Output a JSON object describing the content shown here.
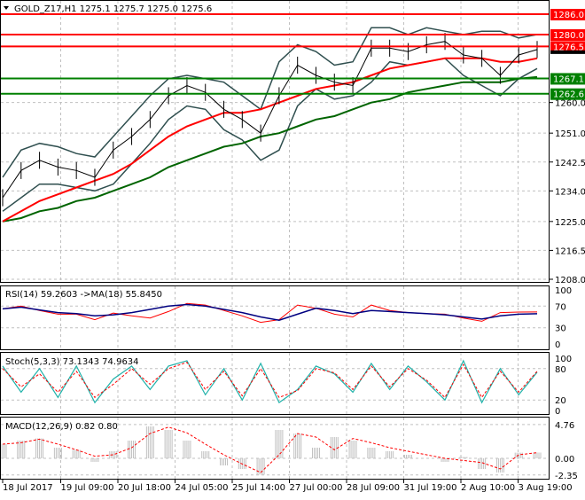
{
  "header": {
    "symbol_line": "GOLD_Z17,H1  1275.1 1275.7 1275.0 1275.6"
  },
  "colors": {
    "resistance": "#ff0000",
    "support": "#008000",
    "ma_fast": "#ff0000",
    "ma_slow": "#006400",
    "bands": "#2f4f4f",
    "rsi": "#ff0000",
    "rsi_ma": "#000080",
    "stoch_main": "#20b2aa",
    "stoch_signal": "#ff0000",
    "macd_hist": "#c0c0c0",
    "macd_signal": "#ff0000"
  },
  "chart_data": [
    {
      "type": "line",
      "title": "GOLD_Z17,H1",
      "ylim": [
        1208.0,
        1286.0
      ],
      "y_ticks": [
        "1260.0",
        "1251.0",
        "1242.5",
        "1234.0",
        "1225.0",
        "1216.5",
        "1208.0"
      ],
      "x_tick_labels": [
        "18 Jul 2017",
        "19 Jul 09:00",
        "20 Jul 18:00",
        "24 Jul 05:00",
        "25 Jul 14:00",
        "27 Jul 00:00",
        "28 Jul 09:00",
        "31 Jul 19:00",
        "2 Aug 10:00",
        "3 Aug 19:00"
      ],
      "levels": [
        {
          "value": "1286.0",
          "kind": "resistance"
        },
        {
          "value": "1280.0",
          "kind": "resistance"
        },
        {
          "value": "1276.5",
          "kind": "resistance"
        },
        {
          "value": "1267.1",
          "kind": "support"
        },
        {
          "value": "1262.6",
          "kind": "support"
        }
      ],
      "current_price": "1275.6",
      "series": {
        "close": [
          1232,
          1240,
          1243,
          1241,
          1240,
          1238,
          1246,
          1250,
          1255,
          1262,
          1265,
          1263,
          1258,
          1255,
          1251,
          1262,
          1271,
          1268,
          1266,
          1265,
          1276,
          1276,
          1275,
          1277,
          1278,
          1274,
          1273,
          1268,
          1274,
          1275.6
        ],
        "bb_upper": [
          1238,
          1246,
          1248,
          1247,
          1245,
          1244,
          1250,
          1256,
          1262,
          1267,
          1268,
          1267,
          1266,
          1262,
          1258,
          1272,
          1277,
          1275,
          1271,
          1272,
          1282,
          1282,
          1280,
          1282,
          1281,
          1280,
          1281,
          1281,
          1279,
          1280
        ],
        "bb_lower": [
          1228,
          1232,
          1236,
          1236,
          1235,
          1234,
          1236,
          1242,
          1248,
          1255,
          1259,
          1258,
          1252,
          1249,
          1243,
          1246,
          1259,
          1264,
          1261,
          1262,
          1266,
          1272,
          1271,
          1272,
          1273,
          1268,
          1265,
          1262,
          1267,
          1270
        ],
        "ma_fast": [
          1225,
          1228,
          1231,
          1233,
          1235,
          1237,
          1239,
          1242,
          1246,
          1250,
          1253,
          1255,
          1257,
          1257,
          1258,
          1260,
          1262,
          1264,
          1265,
          1266,
          1268,
          1270,
          1271,
          1272,
          1273,
          1273,
          1273,
          1272,
          1272,
          1273
        ],
        "ma_slow": [
          1225,
          1226,
          1228,
          1229,
          1231,
          1232,
          1234,
          1236,
          1238,
          1241,
          1243,
          1245,
          1247,
          1248,
          1250,
          1251,
          1253,
          1255,
          1256,
          1258,
          1260,
          1261,
          1263,
          1264,
          1265,
          1266,
          1266,
          1266,
          1267,
          1267.5
        ]
      }
    },
    {
      "type": "line",
      "title": "RSI(14) 59.2603  ->MA(18) 55.8450",
      "ylim": [
        0,
        100
      ],
      "y_ticks": [
        "100",
        "70",
        "30",
        "0"
      ],
      "series": {
        "rsi": [
          65,
          70,
          62,
          55,
          55,
          45,
          57,
          52,
          48,
          60,
          75,
          72,
          62,
          52,
          40,
          45,
          72,
          66,
          55,
          50,
          72,
          62,
          58,
          56,
          55,
          48,
          42,
          58,
          59,
          59.26
        ],
        "ma": [
          65,
          68,
          63,
          58,
          56,
          52,
          54,
          58,
          64,
          70,
          73,
          70,
          64,
          58,
          50,
          44,
          55,
          66,
          62,
          56,
          62,
          60,
          58,
          56,
          54,
          50,
          46,
          52,
          55,
          55.85
        ]
      }
    },
    {
      "type": "line",
      "title": "Stoch(5,3,3) 73.1343 74.9634",
      "ylim": [
        0,
        100
      ],
      "y_ticks": [
        "100",
        "80",
        "20",
        "0"
      ],
      "series": {
        "main": [
          85,
          35,
          80,
          25,
          85,
          15,
          60,
          85,
          40,
          85,
          95,
          30,
          80,
          20,
          90,
          15,
          40,
          85,
          70,
          35,
          90,
          40,
          85,
          55,
          20,
          95,
          15,
          80,
          30,
          73.13
        ],
        "signal": [
          80,
          45,
          70,
          35,
          75,
          25,
          50,
          80,
          50,
          80,
          92,
          40,
          75,
          28,
          80,
          25,
          38,
          80,
          72,
          40,
          85,
          45,
          80,
          58,
          25,
          88,
          25,
          75,
          35,
          74.96
        ]
      }
    },
    {
      "type": "bar",
      "title": "MACD(12,26,9) 0.82 0.80",
      "ylim": [
        -2.35,
        4.76
      ],
      "y_ticks": [
        "4.76",
        "0.00",
        "-2.35"
      ],
      "series": {
        "histogram": [
          2.0,
          2.5,
          2.8,
          1.5,
          1.2,
          -0.5,
          1.0,
          2.5,
          4.5,
          4.0,
          2.5,
          1.0,
          -1.0,
          -1.5,
          -2.3,
          4.0,
          3.5,
          1.5,
          3.0,
          2.5,
          1.5,
          1.0,
          0.5,
          0.0,
          -0.5,
          0.2,
          -1.5,
          -2.0,
          0.8,
          0.82
        ],
        "signal": [
          2.0,
          2.2,
          2.7,
          2.0,
          1.2,
          0.3,
          0.5,
          1.5,
          3.5,
          4.4,
          3.6,
          2.0,
          0.5,
          -0.8,
          -2.0,
          0.5,
          3.5,
          3.0,
          1.2,
          2.8,
          2.2,
          1.5,
          1.0,
          0.5,
          0.0,
          -0.3,
          -0.6,
          -1.5,
          0.5,
          0.8
        ]
      }
    }
  ]
}
